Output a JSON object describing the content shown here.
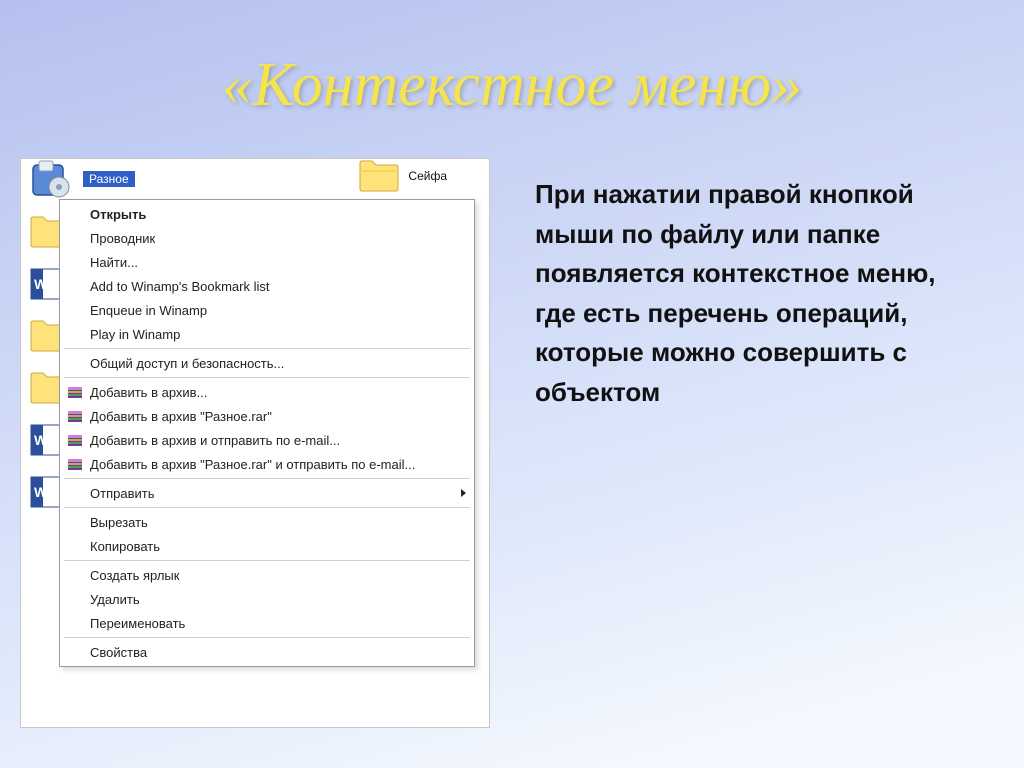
{
  "slide": {
    "title": "«Контекстное меню»",
    "body": "При нажатии правой кнопкой мыши по файлу или папке появляется контекстное меню, где есть перечень операций, которые можно совершить с объектом"
  },
  "desktop": {
    "selected_label": "Разное",
    "right_folder_label": "Сейфа"
  },
  "menu": {
    "open": "Открыть",
    "explorer": "Проводник",
    "find": "Найти...",
    "winamp_bookmark": "Add to Winamp's Bookmark list",
    "winamp_enqueue": "Enqueue in Winamp",
    "winamp_play": "Play in Winamp",
    "sharing": "Общий доступ и безопасность...",
    "rar_add": "Добавить в архив...",
    "rar_add_named": "Добавить в архив \"Разное.rar\"",
    "rar_add_email": "Добавить в архив и отправить по e-mail...",
    "rar_add_named_email": "Добавить в архив \"Разное.rar\" и отправить по e-mail...",
    "send_to": "Отправить",
    "cut": "Вырезать",
    "copy": "Копировать",
    "create_shortcut": "Создать ярлык",
    "delete": "Удалить",
    "rename": "Переименовать",
    "properties": "Свойства"
  }
}
